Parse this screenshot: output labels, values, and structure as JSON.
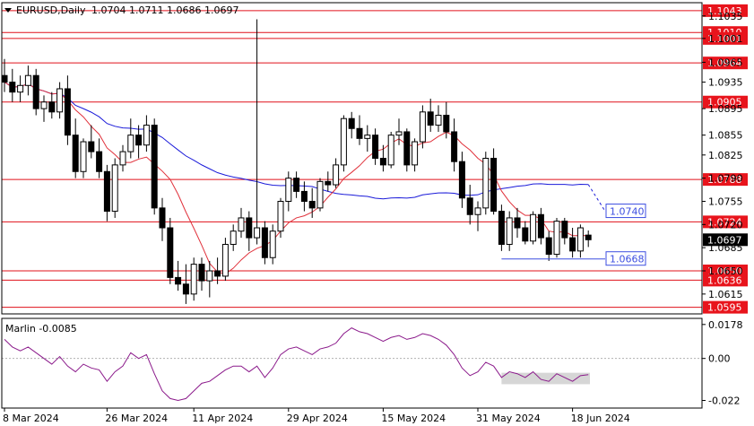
{
  "chart_data": {
    "type": "candlestick",
    "header": {
      "symbol_tf": "EURUSD,Daily",
      "ohlc": "1.0704 1.0711 1.0686 1.0697"
    },
    "price_axis": {
      "ylim": [
        1.0585,
        1.1055
      ],
      "tick_labels": [
        "1.1035",
        "1.1001",
        "1.0965",
        "1.0935",
        "1.0895",
        "1.0855",
        "1.0825",
        "1.0790",
        "1.0755",
        "1.0720",
        "1.0685",
        "1.0650",
        "1.0615"
      ],
      "current_price": "1.0697",
      "current_price_value": 1.0697
    },
    "date_axis": {
      "ticks": [
        {
          "bar": 0,
          "label": "8 Mar 2024"
        },
        {
          "bar": 13,
          "label": "26 Mar 2024"
        },
        {
          "bar": 24,
          "label": "11 Apr 2024"
        },
        {
          "bar": 36,
          "label": "29 Apr 2024"
        },
        {
          "bar": 48,
          "label": "15 May 2024"
        },
        {
          "bar": 60,
          "label": "31 May 2024"
        },
        {
          "bar": 72,
          "label": "18 Jun 2024"
        }
      ]
    },
    "levels": [
      {
        "value": 1.1043,
        "label": "1.1043"
      },
      {
        "value": 1.101,
        "label": "1.1010"
      },
      {
        "value": 1.1001,
        "label": "1.1001"
      },
      {
        "value": 1.0964,
        "label": "1.0964"
      },
      {
        "value": 1.0905,
        "label": "1.0905"
      },
      {
        "value": 1.0788,
        "label": "1.0788"
      },
      {
        "value": 1.0724,
        "label": "1.0724"
      },
      {
        "value": 1.065,
        "label": "1.0650"
      },
      {
        "value": 1.0636,
        "label": "1.0636"
      },
      {
        "value": 1.0595,
        "label": "1.0595"
      }
    ],
    "annotations": [
      {
        "label": "1.0740",
        "value": 1.074
      },
      {
        "label": "1.0668",
        "value": 1.0668
      }
    ],
    "candles": [
      [
        1.0945,
        1.097,
        1.092,
        1.0935
      ],
      [
        1.0935,
        1.0955,
        1.0905,
        1.092
      ],
      [
        1.092,
        1.0945,
        1.0905,
        1.093
      ],
      [
        1.093,
        1.096,
        1.0915,
        1.0945
      ],
      [
        1.0945,
        1.0955,
        1.0885,
        1.0895
      ],
      [
        1.0895,
        1.0915,
        1.0875,
        1.0905
      ],
      [
        1.0905,
        1.092,
        1.088,
        1.089
      ],
      [
        1.089,
        1.0935,
        1.088,
        1.0925
      ],
      [
        1.0925,
        1.0945,
        1.084,
        1.0855
      ],
      [
        1.0855,
        1.088,
        1.079,
        1.08
      ],
      [
        1.08,
        1.085,
        1.079,
        1.0845
      ],
      [
        1.0845,
        1.087,
        1.082,
        1.083
      ],
      [
        1.083,
        1.085,
        1.079,
        1.08
      ],
      [
        1.08,
        1.081,
        1.0725,
        1.074
      ],
      [
        1.074,
        1.082,
        1.073,
        1.081
      ],
      [
        1.081,
        1.084,
        1.08,
        1.083
      ],
      [
        1.083,
        1.088,
        1.082,
        1.0855
      ],
      [
        1.0855,
        1.087,
        1.082,
        1.084
      ],
      [
        1.084,
        1.0885,
        1.083,
        1.087
      ],
      [
        1.087,
        1.088,
        1.0735,
        1.0745
      ],
      [
        1.0745,
        1.076,
        1.0695,
        1.0715
      ],
      [
        1.0715,
        1.073,
        1.063,
        1.064
      ],
      [
        1.064,
        1.0665,
        1.062,
        1.063
      ],
      [
        1.063,
        1.066,
        1.06,
        1.0615
      ],
      [
        1.0615,
        1.067,
        1.0605,
        1.066
      ],
      [
        1.066,
        1.067,
        1.062,
        1.0635
      ],
      [
        1.0635,
        1.0665,
        1.061,
        1.065
      ],
      [
        1.065,
        1.067,
        1.063,
        1.0642
      ],
      [
        1.0642,
        1.07,
        1.0635,
        1.069
      ],
      [
        1.069,
        1.072,
        1.068,
        1.071
      ],
      [
        1.071,
        1.0745,
        1.07,
        1.073
      ],
      [
        1.073,
        1.074,
        1.068,
        1.07
      ],
      [
        1.07,
        1.103,
        1.069,
        1.0715
      ],
      [
        1.0715,
        1.0725,
        1.066,
        1.067
      ],
      [
        1.067,
        1.072,
        1.066,
        1.071
      ],
      [
        1.071,
        1.076,
        1.07,
        1.0755
      ],
      [
        1.0755,
        1.08,
        1.074,
        1.079
      ],
      [
        1.079,
        1.08,
        1.076,
        1.077
      ],
      [
        1.077,
        1.0785,
        1.074,
        1.0755
      ],
      [
        1.0755,
        1.0775,
        1.073,
        1.0745
      ],
      [
        1.0745,
        1.079,
        1.074,
        1.0785
      ],
      [
        1.0785,
        1.08,
        1.077,
        1.078
      ],
      [
        1.078,
        1.082,
        1.0775,
        1.081
      ],
      [
        1.081,
        1.0885,
        1.08,
        1.088
      ],
      [
        1.088,
        1.089,
        1.085,
        1.0865
      ],
      [
        1.0865,
        1.0885,
        1.084,
        1.085
      ],
      [
        1.085,
        1.087,
        1.083,
        1.0855
      ],
      [
        1.0855,
        1.0865,
        1.081,
        1.082
      ],
      [
        1.082,
        1.084,
        1.08,
        1.081
      ],
      [
        1.081,
        1.086,
        1.0805,
        1.0855
      ],
      [
        1.0855,
        1.088,
        1.084,
        1.086
      ],
      [
        1.086,
        1.0865,
        1.08,
        1.081
      ],
      [
        1.081,
        1.085,
        1.08,
        1.0845
      ],
      [
        1.0845,
        1.09,
        1.0835,
        1.089
      ],
      [
        1.089,
        1.091,
        1.086,
        1.087
      ],
      [
        1.087,
        1.09,
        1.086,
        1.0885
      ],
      [
        1.0885,
        1.0905,
        1.085,
        1.086
      ],
      [
        1.086,
        1.088,
        1.08,
        1.0815
      ],
      [
        1.0815,
        1.083,
        1.0745,
        1.076
      ],
      [
        1.076,
        1.078,
        1.072,
        1.0735
      ],
      [
        1.0735,
        1.0755,
        1.071,
        1.0745
      ],
      [
        1.0745,
        1.083,
        1.0735,
        1.082
      ],
      [
        1.082,
        1.0835,
        1.0735,
        1.074
      ],
      [
        1.074,
        1.075,
        1.068,
        1.069
      ],
      [
        1.069,
        1.074,
        1.068,
        1.073
      ],
      [
        1.073,
        1.0745,
        1.07,
        1.0715
      ],
      [
        1.0715,
        1.0725,
        1.069,
        1.0695
      ],
      [
        1.0695,
        1.074,
        1.069,
        1.0735
      ],
      [
        1.0735,
        1.0745,
        1.069,
        1.07
      ],
      [
        1.07,
        1.071,
        1.0665,
        1.0675
      ],
      [
        1.0675,
        1.073,
        1.067,
        1.0725
      ],
      [
        1.0725,
        1.073,
        1.069,
        1.07
      ],
      [
        1.07,
        1.0715,
        1.067,
        1.068
      ],
      [
        1.068,
        1.072,
        1.067,
        1.0715
      ],
      [
        1.0704,
        1.0711,
        1.0686,
        1.0697
      ]
    ],
    "oscillator": {
      "name": "Marlin -0.0085",
      "ylim": [
        -0.026,
        0.021
      ],
      "tick_labels": [
        "0.0178",
        "0.00",
        "-0.022"
      ],
      "tick_values": [
        0.0178,
        0.0,
        -0.022
      ],
      "values": [
        0.01,
        0.006,
        0.004,
        0.006,
        0.003,
        0.0,
        -0.003,
        0.001,
        -0.004,
        -0.007,
        -0.003,
        -0.005,
        -0.006,
        -0.012,
        -0.007,
        -0.004,
        0.003,
        0.0,
        0.002,
        -0.008,
        -0.017,
        -0.021,
        -0.022,
        -0.021,
        -0.017,
        -0.013,
        -0.012,
        -0.009,
        -0.006,
        -0.004,
        -0.004,
        -0.007,
        -0.004,
        -0.01,
        -0.005,
        0.002,
        0.005,
        0.006,
        0.004,
        0.002,
        0.005,
        0.006,
        0.008,
        0.013,
        0.016,
        0.014,
        0.013,
        0.011,
        0.009,
        0.011,
        0.012,
        0.01,
        0.011,
        0.013,
        0.012,
        0.01,
        0.007,
        0.002,
        -0.005,
        -0.009,
        -0.007,
        -0.002,
        -0.004,
        -0.01,
        -0.007,
        -0.008,
        -0.01,
        -0.007,
        -0.011,
        -0.012,
        -0.008,
        -0.01,
        -0.012,
        -0.009,
        -0.0085
      ]
    }
  }
}
